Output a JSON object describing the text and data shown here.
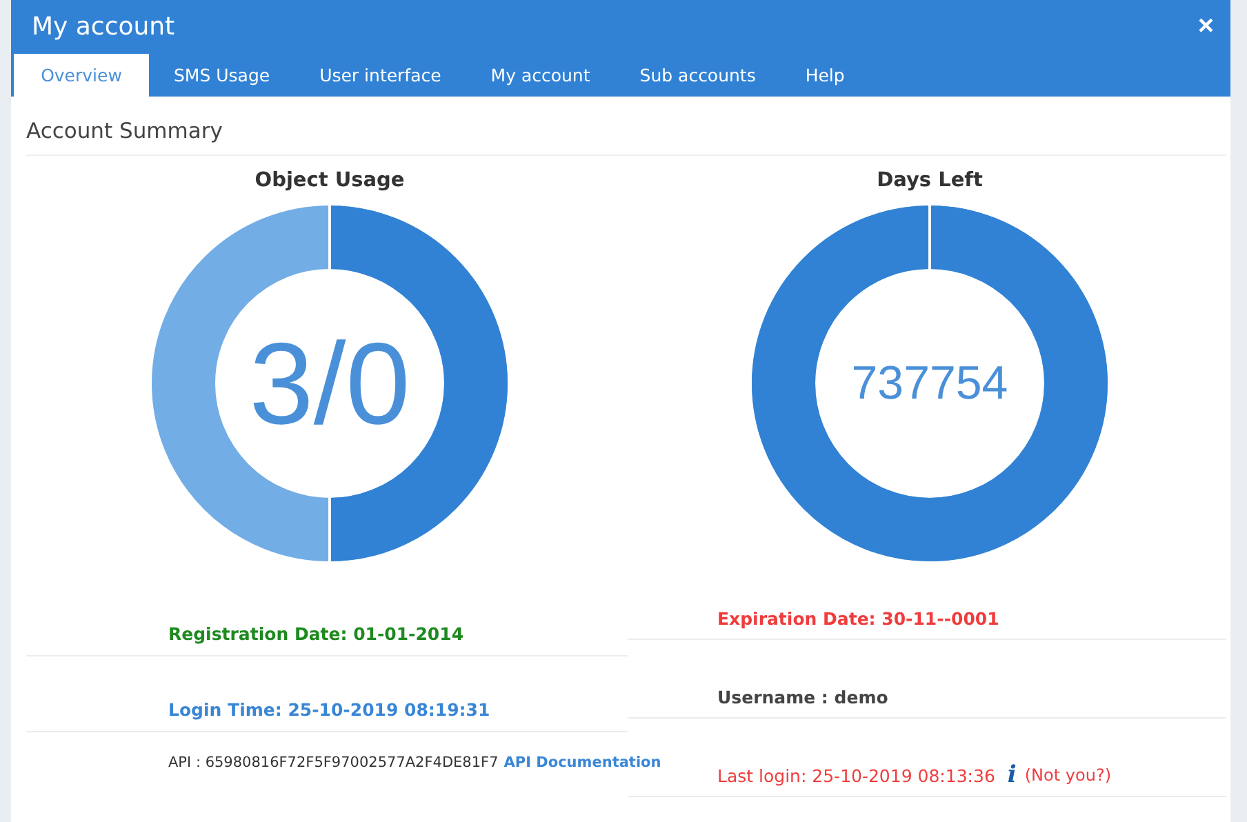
{
  "window": {
    "title": "My account",
    "close": "×"
  },
  "tabs": [
    {
      "label": "Overview",
      "selected": true
    },
    {
      "label": "SMS Usage",
      "selected": false
    },
    {
      "label": "User interface",
      "selected": false
    },
    {
      "label": "My account",
      "selected": false
    },
    {
      "label": "Sub accounts",
      "selected": false
    },
    {
      "label": "Help",
      "selected": false
    }
  ],
  "section_title": "Account Summary",
  "gauges": [
    {
      "title": "Object Usage",
      "value": "3/0",
      "level": 0.5
    },
    {
      "title": "Days Left",
      "value": "737754",
      "level": 1
    }
  ],
  "left_rows": [
    {
      "kind": "text",
      "text": "Registration Date: 01-01-2014",
      "color": "#1e8a1e"
    },
    {
      "kind": "text",
      "text": "Login Time: 25-10-2019 08:19:31",
      "color": "#3a86d6"
    },
    {
      "kind": "api",
      "text": "API : 65980816F72F5F97002577A2F4DE81F7",
      "link": "API Documentation"
    }
  ],
  "right_rows": [
    {
      "kind": "text",
      "text": "Expiration Date: 30-11--0001",
      "color": "#f03c3c"
    },
    {
      "kind": "text",
      "text": "Username : demo",
      "color": "#444444"
    },
    {
      "kind": "login",
      "text": "Last login: 25-10-2019 08:13:36",
      "info": "i",
      "note": "(Not you?)",
      "color": "#f03c3c"
    }
  ]
}
